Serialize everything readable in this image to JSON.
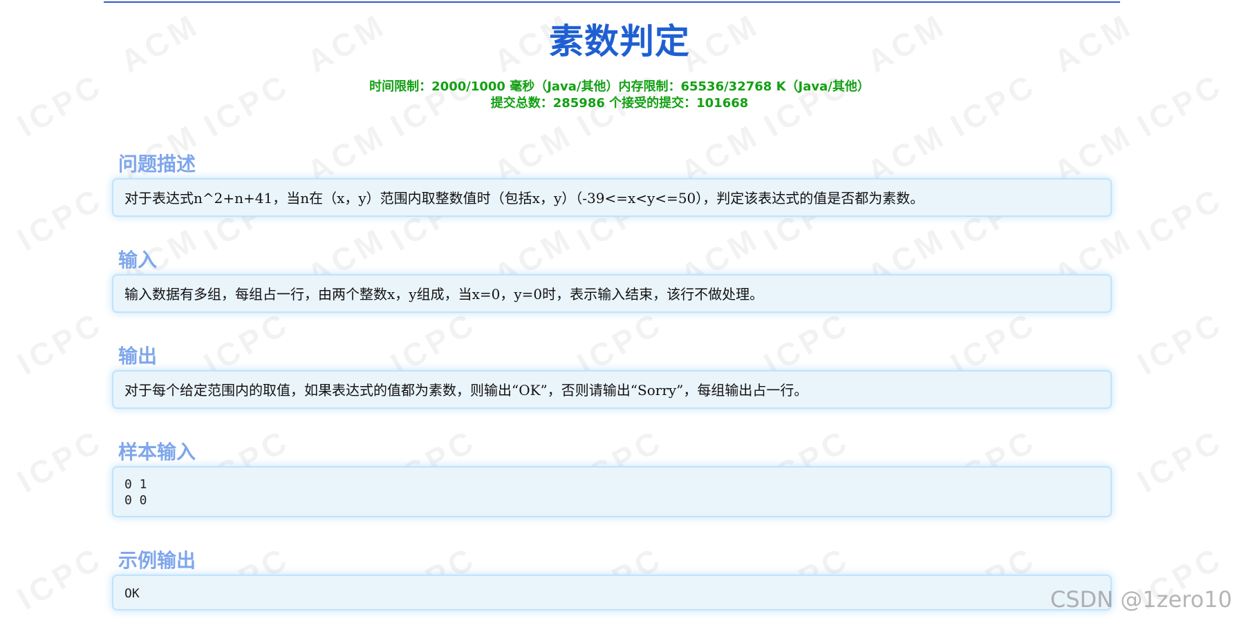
{
  "title": "素数判定",
  "meta": {
    "line1": "时间限制：2000/1000 毫秒（Java/其他）内存限制：65536/32768 K（Java/其他）",
    "line2": "提交总数：285986 个接受的提交：101668"
  },
  "sections": [
    {
      "heading": "问题描述",
      "content": "对于表达式n^2+n+41，当n在（x，y）范围内取整数值时（包括x，y）（-39<=x<y<=50），判定该表达式的值是否都为素数。"
    },
    {
      "heading": "输入",
      "content": "输入数据有多组，每组占一行，由两个整数x，y组成，当x=0，y=0时，表示输入结束，该行不做处理。"
    },
    {
      "heading": "输出",
      "content": "对于每个给定范围内的取值，如果表达式的值都为素数，则输出“OK”，否则请输出“Sorry”，每组输出占一行。"
    },
    {
      "heading": "样本输入",
      "content": "0 1\n0 0"
    },
    {
      "heading": "示例输出",
      "content": "OK"
    }
  ],
  "watermarks": {
    "acm": "ACM",
    "icpc": "ICPC"
  },
  "footer": {
    "watermark": "CSDN @1zero10"
  }
}
